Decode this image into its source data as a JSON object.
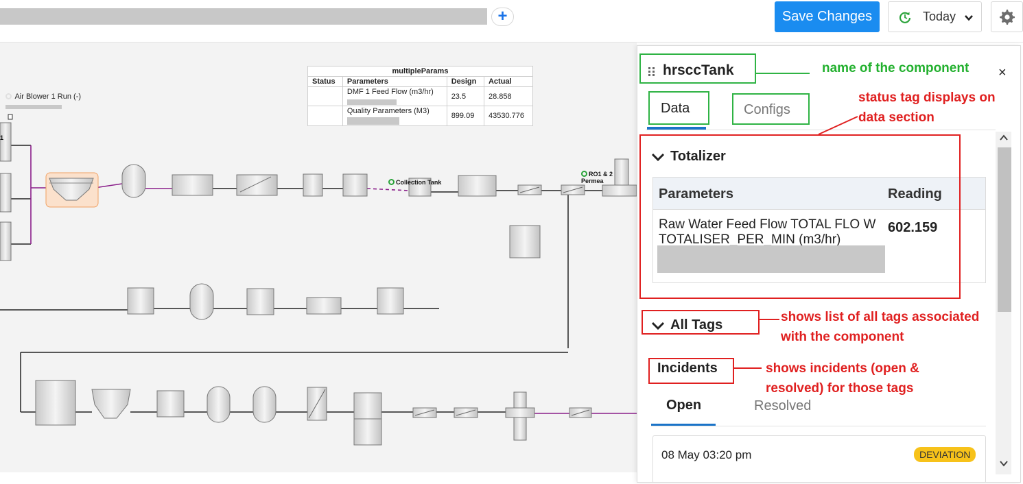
{
  "topbar": {
    "add_label": "+",
    "save_label": "Save Changes",
    "date_label": "Today"
  },
  "canvas": {
    "table": {
      "title": "multipleParams",
      "headers": [
        "Status",
        "Parameters",
        "Design",
        "Actual"
      ],
      "rows": [
        {
          "parameter": "DMF 1 Feed Flow (m3/hr)",
          "design": "23.5",
          "actual": "28.858"
        },
        {
          "parameter": "Quality Parameters (M3)",
          "design": "899.09",
          "actual": "43530.776"
        }
      ]
    },
    "labels": {
      "air_blower": "Air Blower 1 Run (-)",
      "collection_tank": "Collection Tank",
      "ro_permeate": "RO1 & 2 Permea",
      "left_marker": "1"
    }
  },
  "panel": {
    "component_name": "hrsccTank",
    "close_label": "×",
    "tabs": {
      "data": "Data",
      "configs": "Configs"
    },
    "totalizer": {
      "title": "Totalizer",
      "col_param": "Parameters",
      "col_reading": "Reading",
      "param_name": "Raw Water Feed Flow TOTAL FLO W TOTALISER_PER_MIN (m3/hr)",
      "reading": "602.159"
    },
    "all_tags": "All Tags",
    "incidents": {
      "title": "Incidents",
      "tab_open": "Open",
      "tab_resolved": "Resolved",
      "items": [
        {
          "time": "08 May 03:20 pm",
          "badge": "DEVIATION"
        }
      ]
    }
  },
  "annotations": {
    "name_of_component": "name of the component",
    "status_tag_1": "status tag displays on",
    "status_tag_2": "data section",
    "all_tags_1": "shows list of all tags associated",
    "all_tags_2": "with the component",
    "incidents_1": "shows incidents (open &",
    "incidents_2": "resolved)  for those tags"
  },
  "colors": {
    "primary": "#1a8cf0",
    "annotation_green": "#2fb344",
    "annotation_red": "#e02020",
    "badge_yellow": "#f7c21a",
    "pipe_purple": "#8a1e8a"
  }
}
